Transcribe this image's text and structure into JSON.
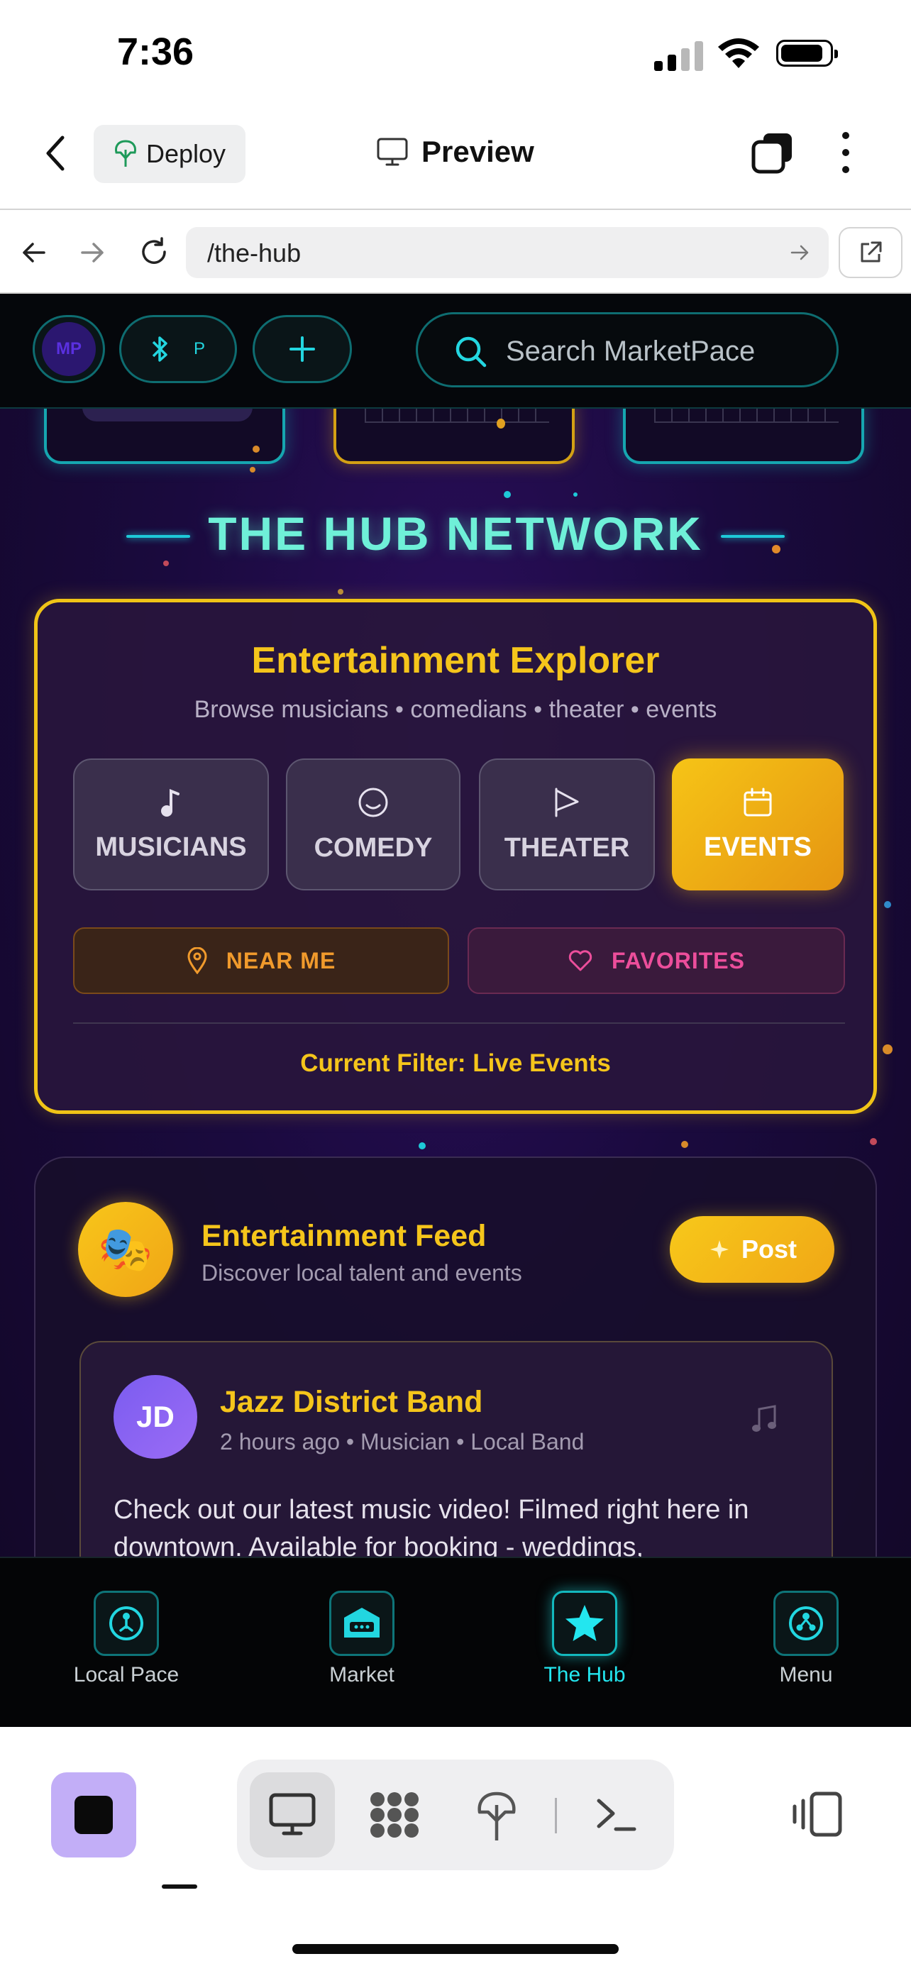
{
  "status_bar": {
    "time": "7:36"
  },
  "app_header": {
    "deploy_label": "Deploy",
    "preview_label": "Preview"
  },
  "browser": {
    "url": "/the-hub"
  },
  "site": {
    "top_bar": {
      "mp_badge": "MP",
      "bt_label": "P",
      "search_placeholder": "Search MarketPace"
    },
    "hub_title": "THE HUB NETWORK",
    "explorer": {
      "title": "Entertainment Explorer",
      "subtitle": "Browse musicians • comedians • theater • events",
      "categories": [
        {
          "label": "MUSICIANS",
          "icon": "music-note-icon",
          "active": false
        },
        {
          "label": "COMEDY",
          "icon": "smile-icon",
          "active": false
        },
        {
          "label": "THEATER",
          "icon": "play-flag-icon",
          "active": false
        },
        {
          "label": "EVENTS",
          "icon": "calendar-icon",
          "active": true
        }
      ],
      "near_me": "NEAR ME",
      "favorites": "FAVORITES",
      "current_filter": "Current Filter: Live Events"
    },
    "feed": {
      "avatar_emoji": "🎭",
      "title": "Entertainment Feed",
      "subtitle": "Discover local talent and events",
      "post_button": "Post",
      "post": {
        "avatar_initials": "JD",
        "author": "Jazz District Band",
        "meta": "2 hours ago • Musician • Local Band",
        "body": "Check out our latest music video! Filmed right here in downtown. Available for booking - weddings,"
      }
    },
    "bottom_nav": [
      {
        "label": "Local Pace",
        "icon": "local-pace-icon",
        "active": false
      },
      {
        "label": "Market",
        "icon": "market-icon",
        "active": false
      },
      {
        "label": "The Hub",
        "icon": "star-icon",
        "active": true
      },
      {
        "label": "Menu",
        "icon": "menu-icon",
        "active": false
      }
    ],
    "colors": {
      "accent_gold": "#f5c51b",
      "accent_cyan": "#23e6ef",
      "background": "#1a0a3e"
    }
  }
}
